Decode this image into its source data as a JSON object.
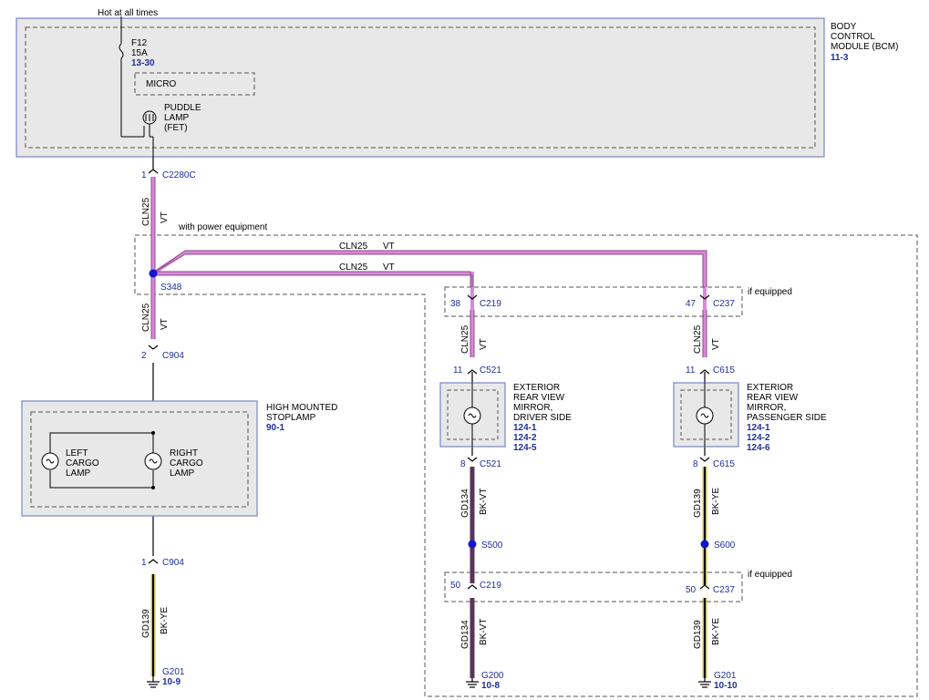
{
  "labels": {
    "hot_at_all_times": "Hot at all times",
    "fuse_name": "F12",
    "fuse_amps": "15A",
    "fuse_ref": "13-30",
    "micro": "MICRO",
    "puddle_lamp_1": "PUDDLE",
    "puddle_lamp_2": "LAMP",
    "puddle_lamp_3": "(FET)",
    "bcm_1": "BODY",
    "bcm_2": "CONTROL",
    "bcm_3": "MODULE (BCM)",
    "bcm_ref": "11-3",
    "with_power_equipment": "with power equipment",
    "if_equipped_top": "if equipped",
    "if_equipped_bottom": "if equipped",
    "hms_1": "HIGH MOUNTED",
    "hms_2": "STOPLAMP",
    "hms_ref": "90-1",
    "left_cargo_1": "LEFT",
    "left_cargo_2": "CARGO",
    "left_cargo_3": "LAMP",
    "right_cargo_1": "RIGHT",
    "right_cargo_2": "CARGO",
    "right_cargo_3": "LAMP",
    "mirror_d_1": "EXTERIOR",
    "mirror_d_2": "REAR VIEW",
    "mirror_d_3": "MIRROR,",
    "mirror_d_4": "DRIVER SIDE",
    "mirror_d_ref1": "124-1",
    "mirror_d_ref2": "124-2",
    "mirror_d_ref3": "124-5",
    "mirror_p_1": "EXTERIOR",
    "mirror_p_2": "REAR VIEW",
    "mirror_p_3": "MIRROR,",
    "mirror_p_4": "PASSENGER SIDE",
    "mirror_p_ref1": "124-1",
    "mirror_p_ref2": "124-2",
    "mirror_p_ref3": "124-6"
  },
  "connectors": {
    "c2280c_pin": "1",
    "c2280c": "C2280C",
    "s348": "S348",
    "c904_top_pin": "2",
    "c904_top": "C904",
    "c904_bot_pin": "1",
    "c904_bot": "C904",
    "c219_top_pin": "38",
    "c219_top": "C219",
    "c237_top_pin": "47",
    "c237_top": "C237",
    "c521_top_pin": "11",
    "c521_top": "C521",
    "c615_top_pin": "11",
    "c615_top": "C615",
    "c521_bot_pin": "8",
    "c521_bot": "C521",
    "c615_bot_pin": "8",
    "c615_bot": "C615",
    "s500": "S500",
    "s600": "S600",
    "c219_bot_pin": "50",
    "c219_bot": "C219",
    "c237_bot_pin": "50",
    "c237_bot": "C237",
    "g201_left": "G201",
    "g201_left_ref": "10-9",
    "g200": "G200",
    "g200_ref": "10-8",
    "g201_right": "G201",
    "g201_right_ref": "10-10"
  },
  "wires": {
    "cln25": "CLN25",
    "vt": "VT",
    "gd134": "GD134",
    "bk_vt": "BK-VT",
    "gd139": "GD139",
    "bk_ye": "BK-YE"
  },
  "colors": {
    "vt": "#d88ad8",
    "bk_vt": "#5a3358",
    "bk_ye": "#c8c25a",
    "module_border": "#7a86c8",
    "module_fill": "#e8e8e8",
    "splice": "#1515cc"
  }
}
